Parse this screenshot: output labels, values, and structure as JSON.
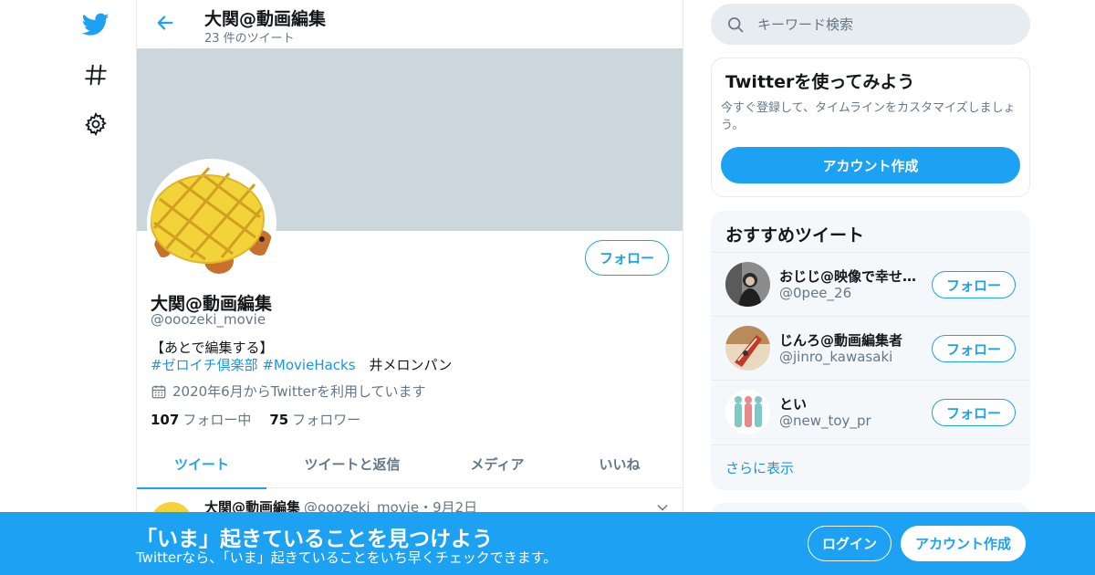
{
  "colors": {
    "accent": "#1da1f2",
    "banner": "#ccd6dd",
    "muted": "#657786",
    "link": "#1b95e0"
  },
  "nav": {
    "icons": [
      "twitter-logo-icon",
      "hashtag-icon",
      "gear-icon"
    ]
  },
  "topbar": {
    "title": "大関@動画編集",
    "tweet_count": "23 件のツイート"
  },
  "profile": {
    "name": "大関@動画編集",
    "handle": "@ooozeki_movie",
    "follow_label": "フォロー",
    "bio_line1": "【あとで編集する】",
    "bio_tag1": "#ゼロイチ倶楽部",
    "bio_tag2": "#MovieHacks",
    "bio_rest": "　井メロンパン",
    "joined": "2020年6月からTwitterを利用しています",
    "following_count": "107",
    "following_label": "フォロー中",
    "followers_count": "75",
    "followers_label": "フォロワー"
  },
  "tabs": [
    {
      "label": "ツイート",
      "active": true
    },
    {
      "label": "ツイートと返信",
      "active": false
    },
    {
      "label": "メディア",
      "active": false
    },
    {
      "label": "いいね",
      "active": false
    }
  ],
  "tweet": {
    "author": "大関@動画編集",
    "meta": "@ooozeki_movie・9月2日"
  },
  "search": {
    "placeholder": "キーワード検索"
  },
  "signup_card": {
    "title": "Twitterを使ってみよう",
    "text": "今すぐ登録して、タイムラインをカスタマイズしましょう。",
    "button": "アカウント作成"
  },
  "recommendations": {
    "title": "おすすめツイート",
    "items": [
      {
        "name": "おじじ@映像で幸せを届けた…",
        "handle": "@0pee_26",
        "follow": "フォロー"
      },
      {
        "name": "じんろ@動画編集者",
        "handle": "@jinro_kawasaki",
        "follow": "フォロー"
      },
      {
        "name": "とい",
        "handle": "@new_toy_pr",
        "follow": "フォロー"
      }
    ],
    "more": "さらに表示"
  },
  "bottombar": {
    "title": "「いま」起きていることを見つけよう",
    "subtitle": "Twitterなら、「いま」起きていることをいち早くチェックできます。",
    "login": "ログイン",
    "signup": "アカウント作成"
  }
}
